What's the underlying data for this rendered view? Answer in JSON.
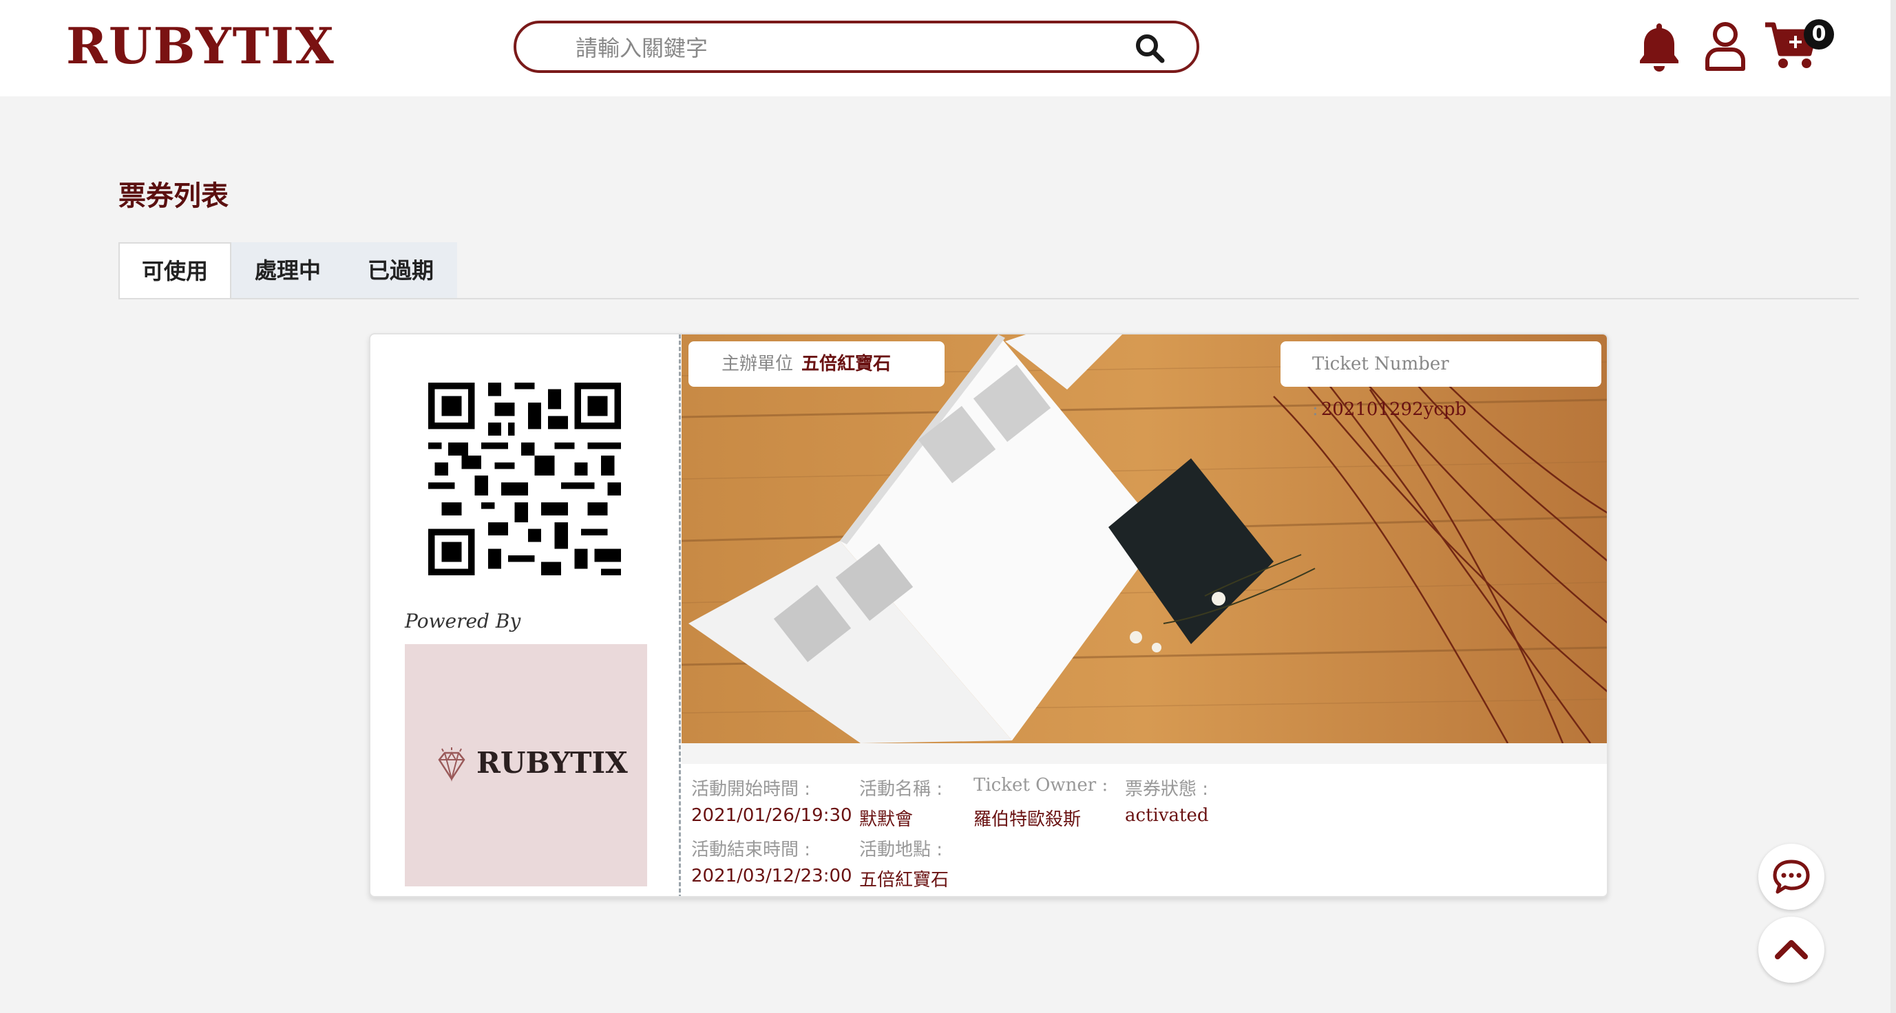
{
  "header": {
    "logo": "RUBYTIX",
    "search_placeholder": "請輸入關鍵字",
    "cart_count": "0",
    "icons": [
      "search-icon",
      "bell-icon",
      "user-icon",
      "cart-icon"
    ]
  },
  "main": {
    "title": "票券列表",
    "tabs": [
      {
        "label": "可使用",
        "active": true
      },
      {
        "label": "處理中",
        "active": false
      },
      {
        "label": "已過期",
        "active": false
      }
    ]
  },
  "ticket": {
    "powered_by": "Powered By",
    "brand_logo": "RUBYTIX",
    "organizer_label": "主辦單位",
    "organizer": "五倍紅寶石",
    "ticket_number_label": "Ticket Number :",
    "ticket_number": "202101292ycpb",
    "start_label": "活動開始時間 :",
    "start_value": "2021/01/26/19:30",
    "end_label": "活動結束時間 :",
    "end_value": "2021/03/12/23:00",
    "name_label": "活動名稱 :",
    "name_value": "默默會",
    "location_label": "活動地點 :",
    "location_value": "五倍紅寶石",
    "owner_label": "Ticket Owner :",
    "owner_value": "羅伯特歐殺斯",
    "status_label": "票券狀態 :",
    "status_value": "activated"
  },
  "colors": {
    "brand": "#7a1212",
    "accent_text": "#6a1212",
    "muted": "#999999",
    "tab_bg": "#e9edf2",
    "powered_box": "#ead9da"
  }
}
